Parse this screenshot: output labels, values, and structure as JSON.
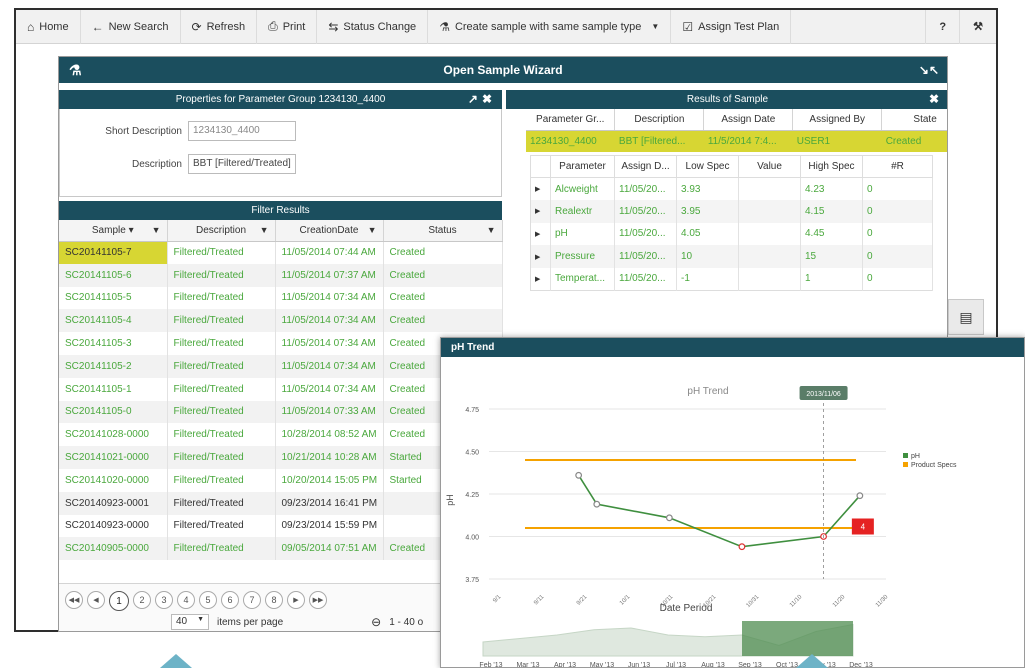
{
  "toolbar": {
    "home": "Home",
    "new_search": "New Search",
    "refresh": "Refresh",
    "print": "Print",
    "status_change": "Status Change",
    "create_sample": "Create sample with same sample type",
    "assign_test_plan": "Assign Test Plan",
    "help": "?"
  },
  "wizard": {
    "title": "Open Sample Wizard"
  },
  "properties": {
    "title": "Properties for Parameter Group 1234130_4400",
    "short_description_label": "Short Description",
    "short_description_value": "1234130_4400",
    "description_label": "Description",
    "description_value": "BBT [Filtered/Treated]"
  },
  "filter_results": {
    "title": "Filter Results",
    "columns": [
      "Sample ▾",
      "Description",
      "CreationDate",
      "Status"
    ],
    "rows": [
      [
        "SC20141105-7",
        "Filtered/Treated",
        "11/05/2014 07:44 AM",
        "Created"
      ],
      [
        "SC20141105-6",
        "Filtered/Treated",
        "11/05/2014 07:37 AM",
        "Created"
      ],
      [
        "SC20141105-5",
        "Filtered/Treated",
        "11/05/2014 07:34 AM",
        "Created"
      ],
      [
        "SC20141105-4",
        "Filtered/Treated",
        "11/05/2014 07:34 AM",
        "Created"
      ],
      [
        "SC20141105-3",
        "Filtered/Treated",
        "11/05/2014 07:34 AM",
        "Created"
      ],
      [
        "SC20141105-2",
        "Filtered/Treated",
        "11/05/2014 07:34 AM",
        "Created"
      ],
      [
        "SC20141105-1",
        "Filtered/Treated",
        "11/05/2014 07:34 AM",
        "Created"
      ],
      [
        "SC20141105-0",
        "Filtered/Treated",
        "11/05/2014 07:33 AM",
        "Created"
      ],
      [
        "SC20141028-0000",
        "Filtered/Treated",
        "10/28/2014 08:52 AM",
        "Created"
      ],
      [
        "SC20141021-0000",
        "Filtered/Treated",
        "10/21/2014 10:28 AM",
        "Started"
      ],
      [
        "SC20141020-0000",
        "Filtered/Treated",
        "10/20/2014 15:05 PM",
        "Started"
      ],
      [
        "SC20140923-0001",
        "Filtered/Treated",
        "09/23/2014 16:41 PM",
        ""
      ],
      [
        "SC20140923-0000",
        "Filtered/Treated",
        "09/23/2014 15:59 PM",
        ""
      ],
      [
        "SC20140905-0000",
        "Filtered/Treated",
        "09/05/2014 07:51 AM",
        "Created"
      ]
    ],
    "pages": [
      "1",
      "2",
      "3",
      "4",
      "5",
      "6",
      "7",
      "8"
    ],
    "per_page": "40",
    "per_page_label": "items per page",
    "range_text": "1 - 40 o"
  },
  "results": {
    "title": "Results of Sample",
    "columns": [
      "Parameter Gr...",
      "Description",
      "Assign Date",
      "Assigned By",
      "State"
    ],
    "group_row": [
      "1234130_4400",
      "BBT [Filtered...",
      "11/5/2014 7:4...",
      "USER1",
      "Created"
    ],
    "param_columns": [
      "Parameter",
      "Assign D...",
      "Low Spec",
      "Value",
      "High Spec",
      "#R"
    ],
    "params": [
      [
        "Alcweight",
        "11/05/20...",
        "3.93",
        "",
        "4.23",
        "0"
      ],
      [
        "Realextr",
        "11/05/20...",
        "3.95",
        "",
        "4.15",
        "0"
      ],
      [
        "pH",
        "11/05/20...",
        "4.05",
        "",
        "4.45",
        "0"
      ],
      [
        "Pressure",
        "11/05/20...",
        "10",
        "",
        "15",
        "0"
      ],
      [
        "Temperat...",
        "11/05/20...",
        "-1",
        "",
        "1",
        "0"
      ]
    ]
  },
  "trend": {
    "title": "pH Trend"
  },
  "chart_data": {
    "type": "line",
    "title": "pH Trend",
    "xlabel": "Date Period",
    "ylabel": "pH",
    "ylim": [
      3.75,
      4.75
    ],
    "yticks": [
      "4.75",
      "4.50",
      "4.25",
      "4.00",
      "3.75"
    ],
    "x_ticks": [
      "9/1",
      "9/11",
      "9/21",
      "10/1",
      "10/11",
      "10/21",
      "10/31",
      "11/10",
      "11/20",
      "11/30"
    ],
    "series": [
      {
        "name": "pH",
        "color": "#3f8f3f",
        "x": [
          9,
          11,
          19,
          27,
          36,
          40
        ],
        "values": [
          4.36,
          4.19,
          4.11,
          3.94,
          4.0,
          4.24
        ]
      },
      {
        "name": "Product Specs",
        "color": "#f5a200",
        "lines": [
          4.45,
          4.05
        ]
      }
    ],
    "tooltip_date": "2013/11/06",
    "highlight_badge": "4",
    "navigator_months": [
      "Feb '13",
      "Mar '13",
      "Apr '13",
      "May '13",
      "Jun '13",
      "Jul '13",
      "Aug '13",
      "Sep '13",
      "Oct '13",
      "Nov '13",
      "Dec '13"
    ],
    "navigator_values": [
      0.4,
      0.5,
      0.6,
      0.75,
      0.8,
      0.6,
      0.55,
      0.6,
      0.3,
      0.7,
      0.9
    ]
  }
}
